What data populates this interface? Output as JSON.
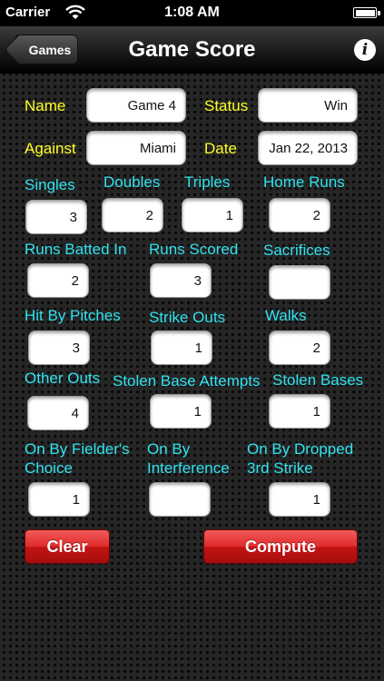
{
  "status_bar": {
    "carrier": "Carrier",
    "time": "1:08 AM"
  },
  "nav": {
    "back_label": "Games",
    "title": "Game Score",
    "info_glyph": "i"
  },
  "fields": {
    "name": {
      "label": "Name",
      "value": "Game 4"
    },
    "status": {
      "label": "Status",
      "value": "Win"
    },
    "against": {
      "label": "Against",
      "value": "Miami"
    },
    "date": {
      "label": "Date",
      "value": "Jan 22, 2013"
    }
  },
  "stats": {
    "singles": {
      "label": "Singles",
      "value": "3"
    },
    "doubles": {
      "label": "Doubles",
      "value": "2"
    },
    "triples": {
      "label": "Triples",
      "value": "1"
    },
    "home_runs": {
      "label": "Home Runs",
      "value": "2"
    },
    "rbi": {
      "label": "Runs Batted In",
      "value": "2"
    },
    "runs_scored": {
      "label": "Runs Scored",
      "value": "3"
    },
    "sacrifices": {
      "label": "Sacrifices",
      "value": ""
    },
    "hbp": {
      "label": "Hit By Pitches",
      "value": "3"
    },
    "strike_outs": {
      "label": "Strike Outs",
      "value": "1"
    },
    "walks": {
      "label": "Walks",
      "value": "2"
    },
    "other_outs": {
      "label": "Other Outs",
      "value": "4"
    },
    "sb_attempts": {
      "label": "Stolen Base Attempts",
      "value": "1"
    },
    "stolen_bases": {
      "label": "Stolen Bases",
      "value": "1"
    },
    "fielders_choice": {
      "label_line1": "On By Fielder's",
      "label_line2": "Choice",
      "value": "1"
    },
    "interference": {
      "label_line1": "On By",
      "label_line2": "Interference",
      "value": ""
    },
    "dropped_third": {
      "label_line1": "On By Dropped",
      "label_line2": "3rd Strike",
      "value": "1"
    }
  },
  "buttons": {
    "clear": "Clear",
    "compute": "Compute"
  },
  "colors": {
    "field_label": "#ffff22",
    "stat_label": "#2fe3f0",
    "button_red": "#e02a2a"
  }
}
